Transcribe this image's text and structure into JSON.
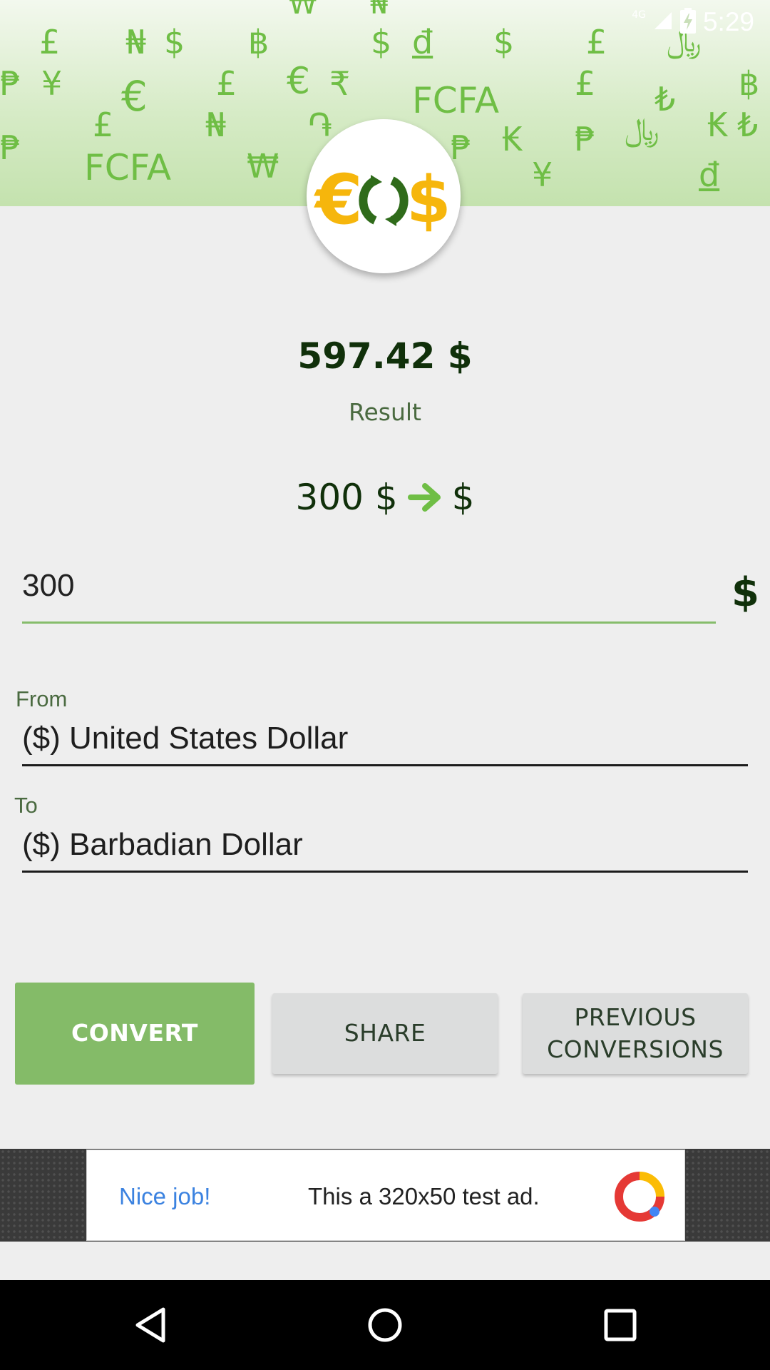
{
  "status_bar": {
    "time": "5:29",
    "network": "4G",
    "icons": [
      "signal-icon",
      "battery-charging-icon"
    ]
  },
  "header": {
    "background_symbols": [
      "₩",
      "₦",
      "£",
      "₦",
      "$",
      "฿",
      "$",
      "đ",
      "$",
      "£",
      "﷼",
      "₱",
      "¥",
      "€",
      "£",
      "€",
      "₹",
      "FCFA",
      "£",
      "₺",
      "฿",
      "₱",
      "£",
      "₦",
      "֏",
      "₱",
      "₭",
      "₱",
      "﷼",
      "₭",
      "₺",
      "FCFA",
      "₩",
      "¥",
      "đ"
    ],
    "logo": {
      "left": "€",
      "right": "$",
      "icon": "exchange-arrows-icon"
    }
  },
  "result": {
    "value": "597.42 $",
    "label": "Result"
  },
  "summary": {
    "from_text": "300 $",
    "to_text": "$",
    "arrow_icon": "arrow-right-icon"
  },
  "amount": {
    "value": "300",
    "symbol": "$"
  },
  "from": {
    "label": "From",
    "value": "($) United States Dollar"
  },
  "to": {
    "label": "To",
    "value": "($) Barbadian Dollar"
  },
  "buttons": {
    "convert": "CONVERT",
    "share": "SHARE",
    "previous_line1": "PREVIOUS",
    "previous_line2": "CONVERSIONS"
  },
  "ad": {
    "title": "Nice job!",
    "text": "This a 320x50 test ad."
  },
  "navbar": {
    "icons": [
      "back-icon",
      "home-icon",
      "recents-icon"
    ]
  },
  "colors": {
    "accent_green": "#84bb68",
    "dark_green": "#10300a",
    "symbol_green": "#6fbe45",
    "logo_yellow": "#f6b60c",
    "ad_blue": "#3b82e0"
  }
}
